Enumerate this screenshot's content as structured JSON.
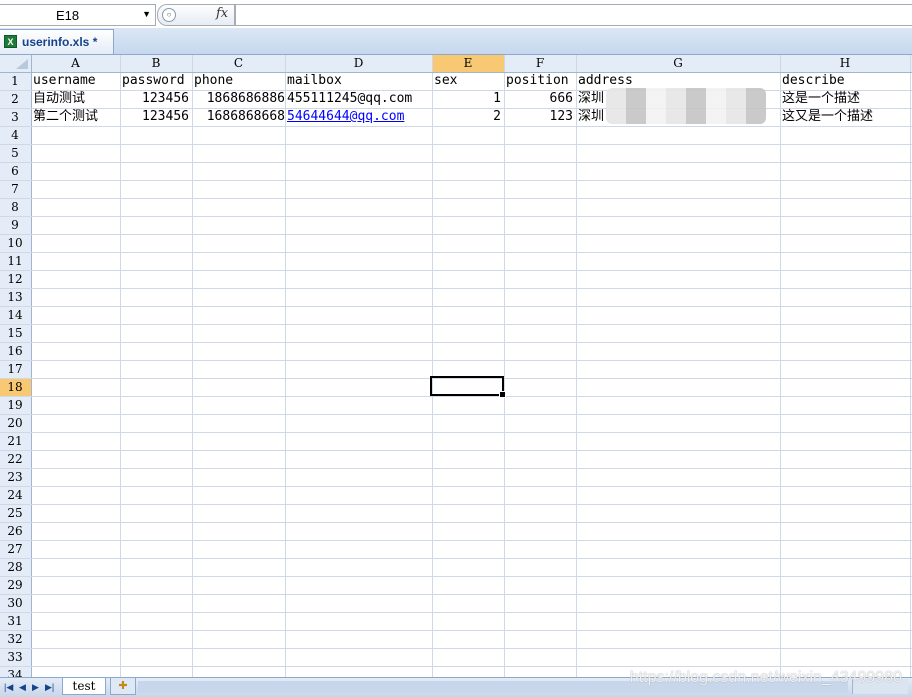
{
  "formula_bar": {
    "name_box": "E18",
    "fx_label": "fx",
    "formula": ""
  },
  "workbook_tab": {
    "label": "userinfo.xls *",
    "icon": "excel-file-icon"
  },
  "columns": [
    "A",
    "B",
    "C",
    "D",
    "E",
    "F",
    "G",
    "H"
  ],
  "selected_column": "E",
  "selected_row": 18,
  "rows": [
    "1",
    "2",
    "3",
    "4",
    "5",
    "6",
    "7",
    "8",
    "9",
    "10",
    "11",
    "12",
    "13",
    "14",
    "15",
    "16",
    "17",
    "18",
    "19",
    "20",
    "21",
    "22",
    "23",
    "24",
    "25",
    "26",
    "27",
    "28",
    "29",
    "30",
    "31",
    "32",
    "33",
    "34"
  ],
  "cells": {
    "r1": {
      "A": "username",
      "B": "password",
      "C": "phone",
      "D": "mailbox",
      "E": "sex",
      "F": "position",
      "G": "address",
      "H": "describe"
    },
    "r2": {
      "A": "自动测试",
      "B": "123456",
      "C": "1868686886",
      "D": "455111245@qq.com",
      "E": "1",
      "F": "666",
      "G": "深圳",
      "H": "这是一个描述"
    },
    "r3": {
      "A": "第二个测试",
      "B": "123456",
      "C": "1686868668",
      "D": "54644644@qq.com",
      "E": "2",
      "F": "123",
      "G": "深圳",
      "H": "这又是一个描述"
    }
  },
  "sheet_tabs": [
    "test"
  ],
  "watermark": "https://blog.csdn.net/weixin_43499980",
  "colors": {
    "header_bg": "#e4ecf7",
    "selected_header": "#f8c873",
    "grid_line": "#d0d7e5",
    "link": "#0000ff"
  }
}
